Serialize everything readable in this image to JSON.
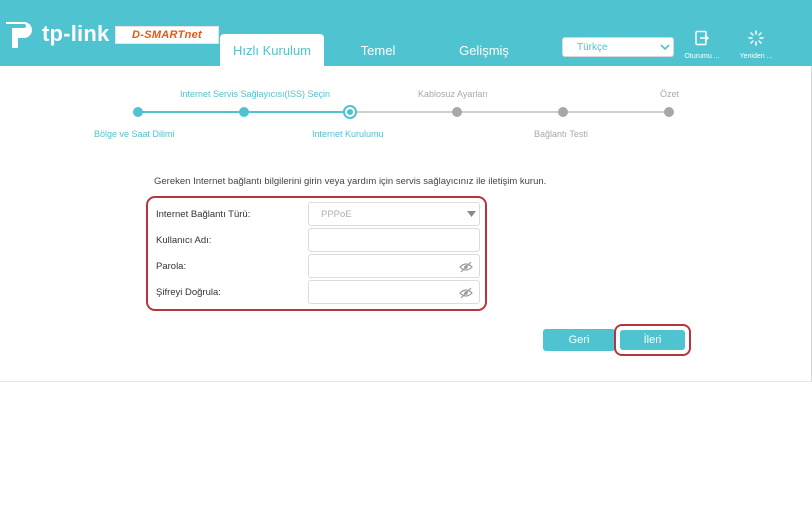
{
  "brand": {
    "logo_text": "tp-link",
    "partner_logo_text": "D-SMARTnet",
    "accent_color": "#4fc3cf",
    "partner_color": "#e05a17"
  },
  "nav": {
    "tabs": [
      {
        "label": "Hızlı Kurulum",
        "active": true
      },
      {
        "label": "Temel",
        "active": false
      },
      {
        "label": "Gelişmiş",
        "active": false
      }
    ],
    "language": {
      "selected": "Türkçe"
    },
    "logout_label": "Oturumu ...",
    "reboot_label": "Yeniden ..."
  },
  "stepper": {
    "steps": [
      {
        "label": "Bölge ve Saat Dilimi",
        "status": "done"
      },
      {
        "label": "Internet Servis Sağlayıcısı(ISS) Seçin",
        "status": "done"
      },
      {
        "label": "Internet Kurulumu",
        "status": "current"
      },
      {
        "label": "Kablosuz Ayarları",
        "status": "pending"
      },
      {
        "label": "Bağlantı Testi",
        "status": "pending"
      },
      {
        "label": "Özet",
        "status": "pending"
      }
    ]
  },
  "form": {
    "instruction": "Gereken Internet bağlantı bilgilerini girin veya yardım için servis sağlayıcınız ile iletişim kurun.",
    "connection_type": {
      "label": "Internet Bağlantı Türü:",
      "value": "PPPoE"
    },
    "username": {
      "label": "Kullanıcı Adı:",
      "value": ""
    },
    "password": {
      "label": "Parola:",
      "value": ""
    },
    "confirm_password": {
      "label": "Şifreyi Doğrula:",
      "value": ""
    },
    "highlight_color": "#b5363f"
  },
  "actions": {
    "back_label": "Geri",
    "next_label": "İleri"
  }
}
